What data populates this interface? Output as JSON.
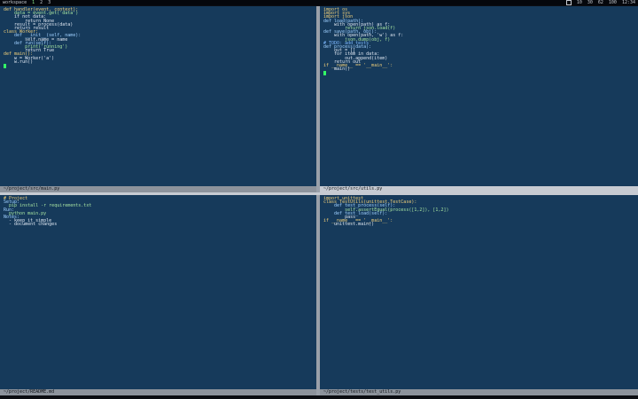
{
  "topbar": {
    "left": [
      "workspace",
      "1",
      "2",
      "3"
    ],
    "right": [
      "10",
      "30",
      "62",
      "100",
      "12:34"
    ]
  },
  "panes": {
    "tl": {
      "status": "~/project/src/main.py",
      "lines": [
        "def handler(event, context):",
        "    data = event.get('data')",
        "    if not data:",
        "        return None",
        "    result = process(data)",
        "    return result",
        "",
        "class Worker:",
        "    def __init__(self, name):",
        "        self.name = name",
        "",
        "    def run(self):",
        "        print('running')",
        "        return True",
        "",
        "def main():",
        "    w = Worker('a')",
        "    w.run()"
      ]
    },
    "tr": {
      "status": "~/project/src/utils.py",
      "lines": [
        "import os",
        "import sys",
        "import json",
        "",
        "def load(path):",
        "    with open(path) as f:",
        "        return json.load(f)",
        "",
        "def save(path, obj):",
        "    with open(path, 'w') as f:",
        "        json.dump(obj, f)",
        "",
        "# TODO: add tests",
        "",
        "def process(data):",
        "    out = []",
        "    for item in data:",
        "        out.append(item)",
        "    return out",
        "",
        "if __name__ == '__main__':",
        "    main()"
      ]
    },
    "bl": {
      "status": "~/project/README.md",
      "lines": [
        "# Project",
        "",
        "Setup:",
        "  pip install -r requirements.txt",
        "",
        "Run:",
        "  python main.py",
        "",
        "Notes:",
        "  - keep it simple",
        "  - document changes"
      ]
    },
    "br": {
      "status": "~/project/tests/test_utils.py",
      "lines": [
        "import unittest",
        "",
        "class TestUtils(unittest.TestCase):",
        "    def test_process(self):",
        "        self.assertEqual(process([1,2]), [1,2])",
        "",
        "    def test_load(self):",
        "        pass",
        "",
        "if __name__ == '__main__':",
        "    unittest.main()"
      ]
    }
  }
}
